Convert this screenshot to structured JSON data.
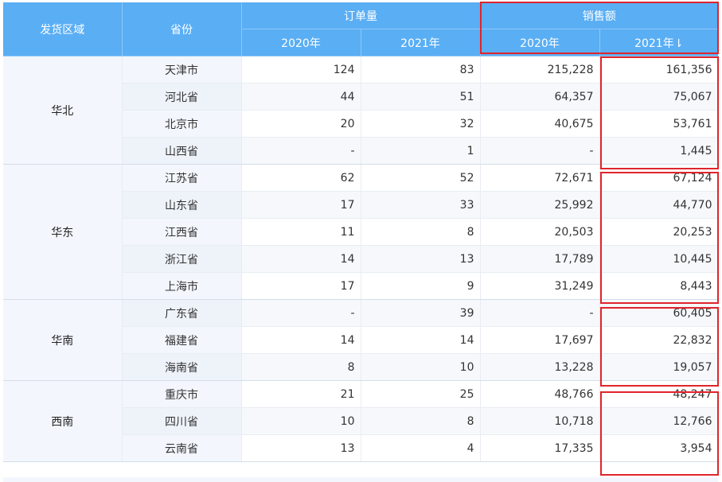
{
  "header": {
    "region": "发货区域",
    "province": "省份",
    "orders": "订单量",
    "sales": "销售额",
    "y2020": "2020年",
    "y2021": "2021年",
    "y2021_sales": "2021年⇂"
  },
  "groups": [
    {
      "region": "华北",
      "rows": [
        {
          "province": "天津市",
          "o2020": "124",
          "o2021": "83",
          "s2020": "215,228",
          "s2021": "161,356"
        },
        {
          "province": "河北省",
          "o2020": "44",
          "o2021": "51",
          "s2020": "64,357",
          "s2021": "75,067"
        },
        {
          "province": "北京市",
          "o2020": "20",
          "o2021": "32",
          "s2020": "40,675",
          "s2021": "53,761"
        },
        {
          "province": "山西省",
          "o2020": "-",
          "o2021": "1",
          "s2020": "-",
          "s2021": "1,445"
        }
      ]
    },
    {
      "region": "华东",
      "rows": [
        {
          "province": "江苏省",
          "o2020": "62",
          "o2021": "52",
          "s2020": "72,671",
          "s2021": "67,124"
        },
        {
          "province": "山东省",
          "o2020": "17",
          "o2021": "33",
          "s2020": "25,992",
          "s2021": "44,770"
        },
        {
          "province": "江西省",
          "o2020": "11",
          "o2021": "8",
          "s2020": "20,503",
          "s2021": "20,253"
        },
        {
          "province": "浙江省",
          "o2020": "14",
          "o2021": "13",
          "s2020": "17,789",
          "s2021": "10,445"
        },
        {
          "province": "上海市",
          "o2020": "17",
          "o2021": "9",
          "s2020": "31,249",
          "s2021": "8,443"
        }
      ]
    },
    {
      "region": "华南",
      "rows": [
        {
          "province": "广东省",
          "o2020": "-",
          "o2021": "39",
          "s2020": "-",
          "s2021": "60,405"
        },
        {
          "province": "福建省",
          "o2020": "14",
          "o2021": "14",
          "s2020": "17,697",
          "s2021": "22,832"
        },
        {
          "province": "海南省",
          "o2020": "8",
          "o2021": "10",
          "s2020": "13,228",
          "s2021": "19,057"
        }
      ]
    },
    {
      "region": "西南",
      "rows": [
        {
          "province": "重庆市",
          "o2020": "21",
          "o2021": "25",
          "s2020": "48,766",
          "s2021": "48,247"
        },
        {
          "province": "四川省",
          "o2020": "10",
          "o2021": "8",
          "s2020": "10,718",
          "s2021": "12,766"
        },
        {
          "province": "云南省",
          "o2020": "13",
          "o2021": "4",
          "s2020": "17,335",
          "s2021": "3,954"
        }
      ]
    }
  ],
  "colors": {
    "header_bg": "#5aaef4",
    "highlight": "#e0252b",
    "region_bg": "#f3f7fd"
  }
}
